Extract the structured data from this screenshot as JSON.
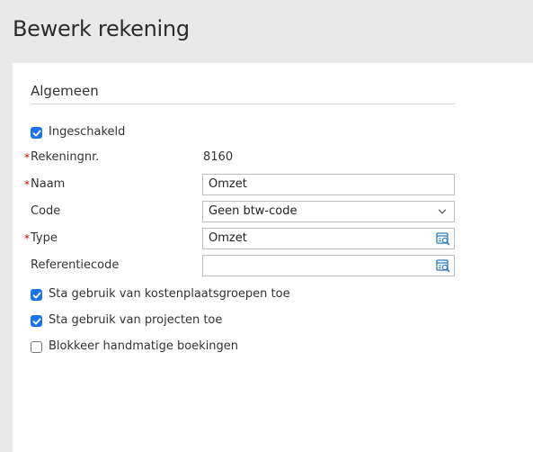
{
  "page": {
    "title": "Bewerk rekening"
  },
  "section": {
    "title": "Algemeen"
  },
  "form": {
    "required_mark": "*",
    "enabled": {
      "label": "Ingeschakeld",
      "checked": true
    },
    "account_number": {
      "label": "Rekeningnr.",
      "value": "8160",
      "required": true
    },
    "name": {
      "label": "Naam",
      "value": "Omzet",
      "required": true
    },
    "code": {
      "label": "Code",
      "selected": "Geen btw-code",
      "icon": "chevron-down-icon"
    },
    "type": {
      "label": "Type",
      "value": "Omzet",
      "required": true,
      "icon": "lookup-icon"
    },
    "reference_code": {
      "label": "Referentiecode",
      "value": "",
      "icon": "lookup-icon"
    },
    "allow_cost_center_groups": {
      "label": "Sta gebruik van kostenplaatsgroepen toe",
      "checked": true
    },
    "allow_projects": {
      "label": "Sta gebruik van projecten toe",
      "checked": true
    },
    "block_manual_entries": {
      "label": "Blokkeer handmatige boekingen",
      "checked": false
    }
  },
  "colors": {
    "accent": "#1a73e8",
    "required": "#cc0000",
    "lookup_icon": "#2f7cc4",
    "header_bg": "#e9e9e9",
    "panel_bg": "#ffffff"
  }
}
